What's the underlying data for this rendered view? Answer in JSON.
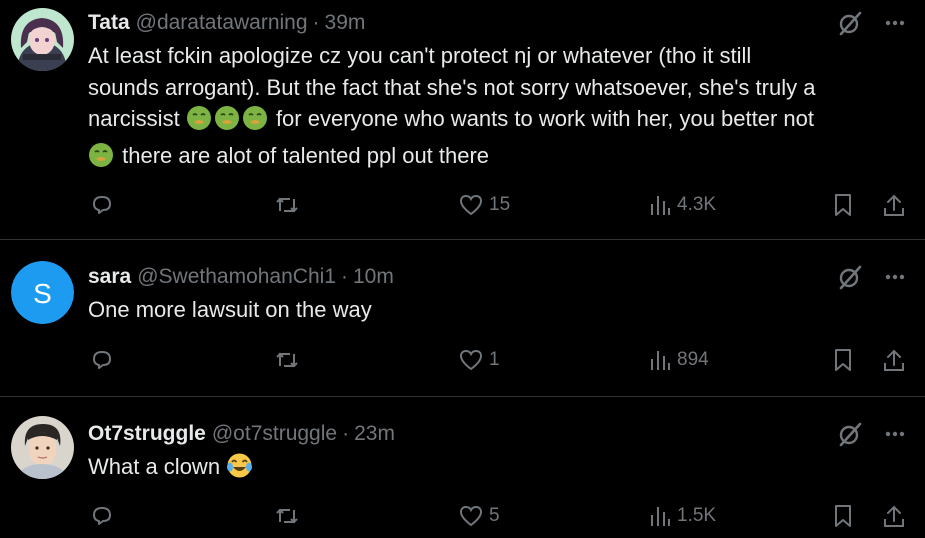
{
  "tweets": [
    {
      "name": "Tata",
      "handle": "@daratatawarning",
      "separator": "·",
      "time": "39m",
      "lines": [
        "At least fckin apologize cz you can't protect nj or whatever (tho it still",
        "sounds arrogant). But the fact that she's not sorry whatsoever, she's truly a",
        "narcissist",
        "for everyone who wants to work with her, you better not",
        "there are alot of talented ppl out there"
      ],
      "emoji_icon": "nauseated-face-icon",
      "likes": "15",
      "views": "4.3K"
    },
    {
      "name": "sara",
      "handle": "@SwethamohanChi1",
      "separator": "·",
      "time": "10m",
      "avatar_letter": "S",
      "avatar_color": "#1d9bf0",
      "text": "One more lawsuit on the way",
      "likes": "1",
      "views": "894"
    },
    {
      "name": "Ot7struggle",
      "handle": "@ot7struggle",
      "separator": "·",
      "time": "23m",
      "text": "What a clown",
      "emoji_icon": "tears-of-joy-icon",
      "likes": "5",
      "views": "1.5K"
    }
  ],
  "colors": {
    "background": "#000000",
    "text": "#e7e9ea",
    "muted": "#71767b",
    "divider": "#2f3336"
  },
  "icons": [
    "grok-icon",
    "more-icon",
    "reply-icon",
    "retweet-icon",
    "like-icon",
    "views-icon",
    "bookmark-icon",
    "share-icon"
  ]
}
